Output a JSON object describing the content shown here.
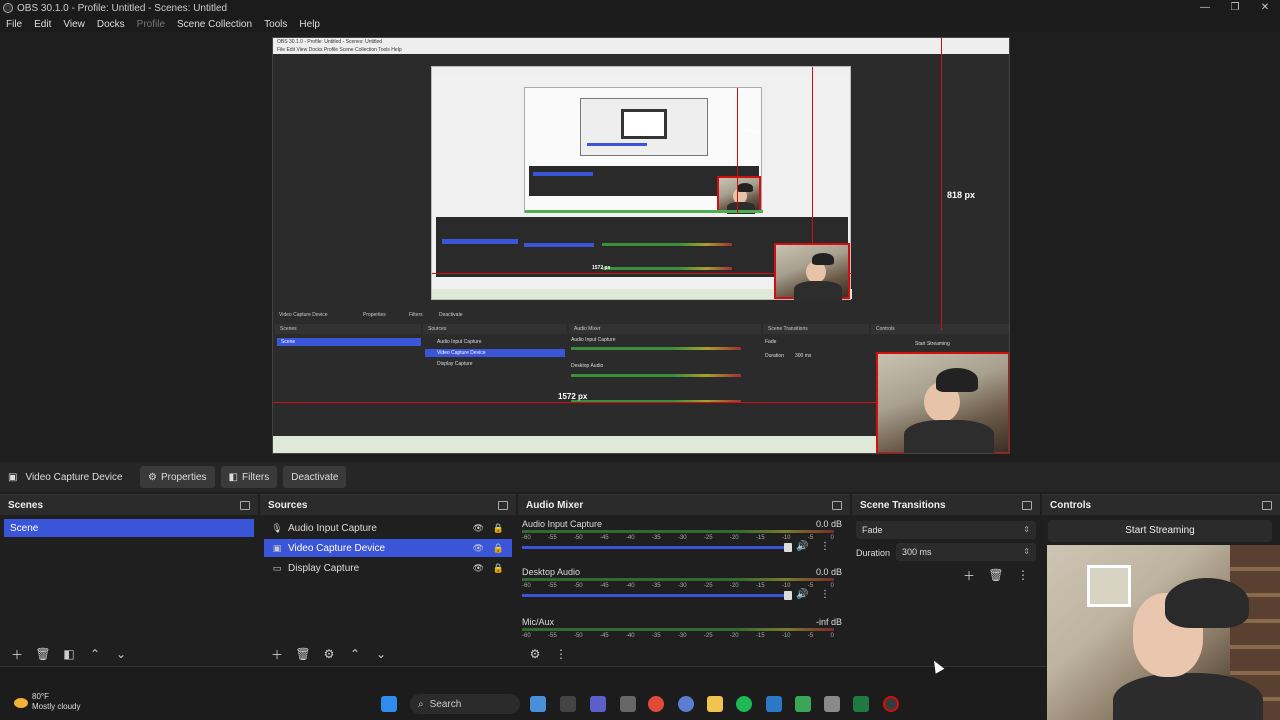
{
  "window": {
    "title": "OBS 30.1.0 - Profile: Untitled - Scenes: Untitled",
    "controls": [
      "—",
      "❐",
      "✕"
    ]
  },
  "menu": {
    "items": [
      "File",
      "Edit",
      "View",
      "Docks",
      "Profile",
      "Scene Collection",
      "Tools",
      "Help"
    ]
  },
  "preview": {
    "measure_vertical": "818 px",
    "measure_horizontal": "1572 px",
    "nested_measure_small": "818 px",
    "nested_measure_small2": "1572 px",
    "nested": {
      "title": "OBS 30.1.0 - Profile: Untitled - Scenes: Untitled",
      "menu": "File   Edit   View   Docks   Profile   Scene Collection   Tools   Help",
      "source_toolbar": [
        "Video Capture Device",
        "Properties",
        "Filters",
        "Deactivate"
      ],
      "panels": [
        "Scenes",
        "Sources",
        "Audio Mixer",
        "Scene Transitions",
        "Controls"
      ],
      "scene": "Scene",
      "sources": [
        "Audio Input Capture",
        "Video Capture Device",
        "Display Capture"
      ],
      "mixer": [
        "Audio Input Capture",
        "Desktop Audio"
      ],
      "transition": "Fade",
      "duration": "Duration",
      "duration_val": "300 ms",
      "start": "Start Streaming"
    }
  },
  "source_toolbar": {
    "name": "Video Capture Device",
    "properties": "Properties",
    "filters": "Filters",
    "deactivate": "Deactivate"
  },
  "scenes": {
    "title": "Scenes",
    "items": [
      {
        "label": "Scene",
        "selected": true
      }
    ]
  },
  "sources": {
    "title": "Sources",
    "items": [
      {
        "label": "Audio Input Capture",
        "icon": "microphone-icon",
        "selected": false
      },
      {
        "label": "Video Capture Device",
        "icon": "camera-icon",
        "selected": true
      },
      {
        "label": "Display Capture",
        "icon": "monitor-icon",
        "selected": false
      }
    ]
  },
  "mixer": {
    "title": "Audio Mixer",
    "scale": [
      "-60",
      "-55",
      "-50",
      "-45",
      "-40",
      "-35",
      "-30",
      "-25",
      "-20",
      "-15",
      "-10",
      "-5",
      "0"
    ],
    "channels": [
      {
        "name": "Audio Input Capture",
        "db": "0.0 dB"
      },
      {
        "name": "Desktop Audio",
        "db": "0.0 dB"
      },
      {
        "name": "Mic/Aux",
        "db": "-inf dB"
      }
    ]
  },
  "transitions": {
    "title": "Scene Transitions",
    "selected": "Fade",
    "duration_label": "Duration",
    "duration_value": "300 ms"
  },
  "controls": {
    "title": "Controls",
    "start_streaming": "Start Streaming"
  },
  "taskbar": {
    "weather_temp": "80°F",
    "weather_desc": "Mostly cloudy",
    "search": "Search"
  },
  "colors": {
    "selection": "#3a55d8",
    "guide_red": "#d01010"
  }
}
